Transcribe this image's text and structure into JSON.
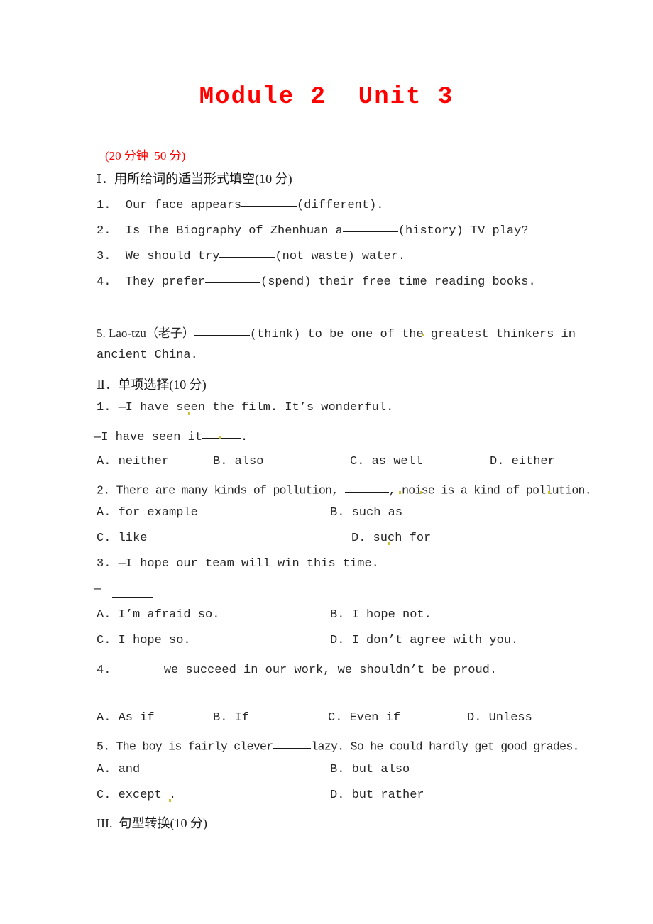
{
  "document": {
    "title": "Module 2  Unit 3",
    "title_color": "#ff0000",
    "score_line": "(20 分钟  50 分)",
    "score_color": "#ff0000",
    "page_background": "#ffffff"
  },
  "sections": [
    {
      "id": "section-1",
      "heading": "Ⅰ．用所给词的适当形式填空(10 分)",
      "questions": [
        {
          "number": "1.",
          "text_before": "1.  Our face appears",
          "blank": "b-lg",
          "text_after": "(different)."
        },
        {
          "number": "2.",
          "text_before": "2.  Is The Biography of Zhenhuan a",
          "blank": "b-lg",
          "text_after": "(history) TV play?"
        },
        {
          "number": "3.",
          "text_before": "3.  We should try",
          "blank": "b-lg",
          "text_after": "(not waste) water."
        },
        {
          "number": "4.",
          "text_before": "4.  They prefer",
          "blank": "b-lg",
          "text_after": "(spend) their free time reading books."
        },
        {
          "number": "5.",
          "text_before": "5. Lao-tzu（老子）",
          "blank": "b-lg",
          "text_after": "(think) to be one of the greatest thinkers in",
          "continuation": "ancient China."
        }
      ]
    },
    {
      "id": "section-2",
      "heading": "Ⅱ．单项选择(10 分)",
      "questions": [
        {
          "number": "1.",
          "stem": "1. —I have seen the film. It’s wonderful.",
          "stem2_before": "—I have seen it",
          "stem2_blank": "b-sm",
          "stem2_after": ".",
          "options_layout": "four-column",
          "options": [
            "A. neither",
            "B. also",
            "C. as well",
            "D. either"
          ]
        },
        {
          "number": "2.",
          "stem_before": "2. There are many kinds of pollution, ",
          "stem_blank": "b-md",
          "stem_after": ", noise is a kind of pollution.",
          "options_layout": "two-column",
          "options": [
            "A. for example",
            "B. such as",
            "C. like",
            "D. such for"
          ]
        },
        {
          "number": "3.",
          "stem": "3. —I hope our team will win this time.",
          "stem2": "—",
          "stem2_has_rule": true,
          "options_layout": "two-column",
          "options": [
            "A. I’m afraid so.",
            "B. I hope not.",
            "C. I hope so.",
            "D. I don’t agree with you."
          ]
        },
        {
          "number": "4.",
          "stem_before": "4.  ",
          "stem_blank": "b-sm",
          "stem_after": "we succeed in our work, we shouldn’t be proud.",
          "options_layout": "four-column",
          "options": [
            "A. As if",
            "B. If",
            "C. Even if",
            "D. Unless"
          ]
        },
        {
          "number": "5.",
          "stem_before": "5. The boy is fairly clever",
          "stem_blank": "b-sm",
          "stem_after": "lazy. So he could hardly get good grades.",
          "options_layout": "two-column",
          "options": [
            "A. and",
            "B. but also",
            "C. except .",
            "D. but rather"
          ]
        }
      ]
    },
    {
      "id": "section-3",
      "heading": "III.  句型转换(10 分)",
      "questions": []
    }
  ]
}
